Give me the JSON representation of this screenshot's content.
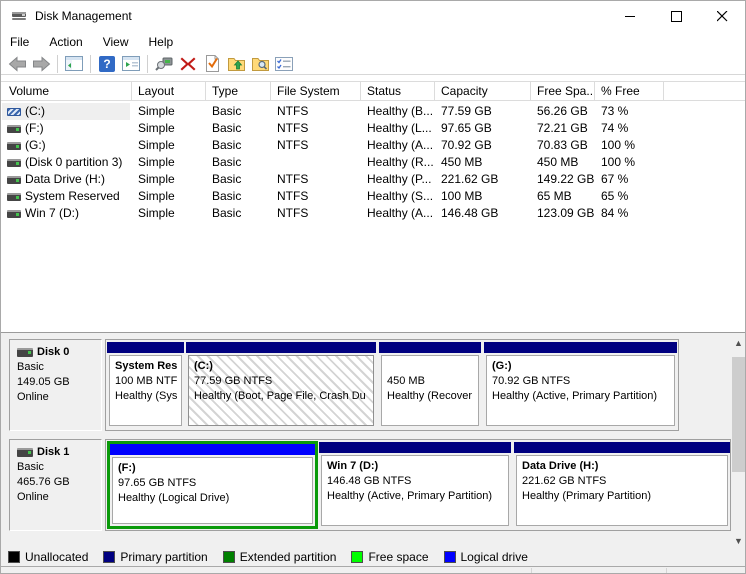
{
  "window": {
    "title": "Disk Management"
  },
  "menu": {
    "items": [
      "File",
      "Action",
      "View",
      "Help"
    ]
  },
  "toolbar": {
    "buttons": [
      "back",
      "forward",
      "show-console-tree",
      "help",
      "show-action-pane",
      "device-view",
      "delete-volume",
      "mark-partition",
      "open",
      "explore",
      "customize-view"
    ]
  },
  "volume_table": {
    "columns": [
      "Volume",
      "Layout",
      "Type",
      "File System",
      "Status",
      "Capacity",
      "Free Spa...",
      "% Free"
    ],
    "rows": [
      {
        "volume": "(C:)",
        "layout": "Simple",
        "type": "Basic",
        "file_system": "NTFS",
        "status": "Healthy (B...",
        "capacity": "77.59 GB",
        "free_space": "56.26 GB",
        "pct_free": "73 %"
      },
      {
        "volume": "(F:)",
        "layout": "Simple",
        "type": "Basic",
        "file_system": "NTFS",
        "status": "Healthy (L...",
        "capacity": "97.65 GB",
        "free_space": "72.21 GB",
        "pct_free": "74 %"
      },
      {
        "volume": "(G:)",
        "layout": "Simple",
        "type": "Basic",
        "file_system": "NTFS",
        "status": "Healthy (A...",
        "capacity": "70.92 GB",
        "free_space": "70.83 GB",
        "pct_free": "100 %"
      },
      {
        "volume": "(Disk 0 partition 3)",
        "layout": "Simple",
        "type": "Basic",
        "file_system": "",
        "status": "Healthy (R...",
        "capacity": "450 MB",
        "free_space": "450 MB",
        "pct_free": "100 %"
      },
      {
        "volume": "Data Drive (H:)",
        "layout": "Simple",
        "type": "Basic",
        "file_system": "NTFS",
        "status": "Healthy (P...",
        "capacity": "221.62 GB",
        "free_space": "149.22 GB",
        "pct_free": "67 %"
      },
      {
        "volume": "System Reserved",
        "layout": "Simple",
        "type": "Basic",
        "file_system": "NTFS",
        "status": "Healthy (S...",
        "capacity": "100 MB",
        "free_space": "65 MB",
        "pct_free": "65 %"
      },
      {
        "volume": "Win 7 (D:)",
        "layout": "Simple",
        "type": "Basic",
        "file_system": "NTFS",
        "status": "Healthy (A...",
        "capacity": "146.48 GB",
        "free_space": "123.09 GB",
        "pct_free": "84 %"
      }
    ]
  },
  "disks": [
    {
      "name": "Disk 0",
      "type": "Basic",
      "size": "149.05 GB",
      "status": "Online",
      "partitions": [
        {
          "name": "System Res",
          "line2": "100 MB NTF",
          "line3": "Healthy (Sys",
          "bar": "#000080"
        },
        {
          "name": "(C:)",
          "line2": "77.59 GB NTFS",
          "line3": "Healthy (Boot, Page File, Crash Du",
          "bar": "#000080"
        },
        {
          "name": "",
          "line2": "450 MB",
          "line3": "Healthy (Recover",
          "bar": "#000080"
        },
        {
          "name": "(G:)",
          "line2": "70.92 GB NTFS",
          "line3": "Healthy (Active, Primary Partition)",
          "bar": "#000080"
        }
      ]
    },
    {
      "name": "Disk 1",
      "type": "Basic",
      "size": "465.76 GB",
      "status": "Online",
      "partitions": [
        {
          "name": "(F:)",
          "line2": "97.65 GB NTFS",
          "line3": "Healthy (Logical Drive)",
          "bar": "#0000ff"
        },
        {
          "name": "Win 7  (D:)",
          "line2": "146.48 GB NTFS",
          "line3": "Healthy (Active, Primary Partition)",
          "bar": "#000080"
        },
        {
          "name": "Data Drive  (H:)",
          "line2": "221.62 GB NTFS",
          "line3": "Healthy (Primary Partition)",
          "bar": "#000080"
        }
      ]
    }
  ],
  "legend": {
    "items": [
      {
        "label": "Unallocated",
        "color": "#000000"
      },
      {
        "label": "Primary partition",
        "color": "#000080"
      },
      {
        "label": "Extended partition",
        "color": "#008000"
      },
      {
        "label": "Free space",
        "color": "#00ff00"
      },
      {
        "label": "Logical drive",
        "color": "#0000ff"
      }
    ]
  },
  "colors": {
    "extended_border": "#0a9a0a",
    "selection_bg": "#efefef"
  }
}
